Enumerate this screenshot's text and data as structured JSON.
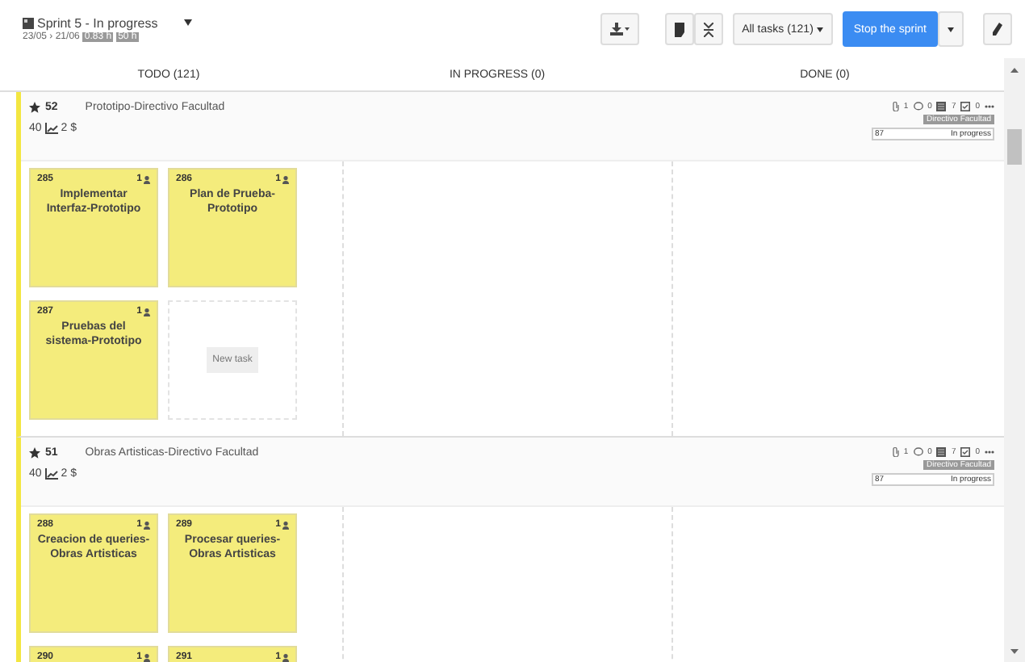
{
  "sprint": {
    "title": "Sprint 5 - In progress",
    "dates": "23/05 › 21/06",
    "badges": [
      "0.83 h",
      "50 h"
    ]
  },
  "toolbar": {
    "filter": "All tasks (121)",
    "primary": "Stop the sprint"
  },
  "columns": [
    {
      "label": "TODO (121)"
    },
    {
      "label": "IN PROGRESS (0)"
    },
    {
      "label": "DONE (0)"
    }
  ],
  "stories": [
    {
      "points": "52",
      "title": "Prototipo-Directivo Facultad",
      "estimate": "40",
      "cost": "2 $",
      "attachments": "1",
      "comments": "0",
      "tasks": "7",
      "checks": "0",
      "owner": "Directivo Facultad",
      "progress": "87",
      "status": "In progress",
      "new_task": "New task",
      "cards": [
        {
          "number": "285",
          "count": "1",
          "title": "Implementar Interfaz-Prototipo"
        },
        {
          "number": "286",
          "count": "1",
          "title": "Plan de Prueba-Prototipo"
        },
        {
          "number": "287",
          "count": "1",
          "title": "Pruebas del sistema-Prototipo"
        }
      ]
    },
    {
      "points": "51",
      "title": "Obras Artisticas-Directivo Facultad",
      "estimate": "40",
      "cost": "2 $",
      "attachments": "1",
      "comments": "0",
      "tasks": "7",
      "checks": "0",
      "owner": "Directivo Facultad",
      "progress": "87",
      "status": "In progress",
      "cards": [
        {
          "number": "288",
          "count": "1",
          "title": "Creacion de queries-Obras Artisticas"
        },
        {
          "number": "289",
          "count": "1",
          "title": "Procesar queries-Obras Artisticas"
        },
        {
          "number": "290",
          "count": "1"
        },
        {
          "number": "291",
          "count": "1"
        }
      ]
    }
  ]
}
